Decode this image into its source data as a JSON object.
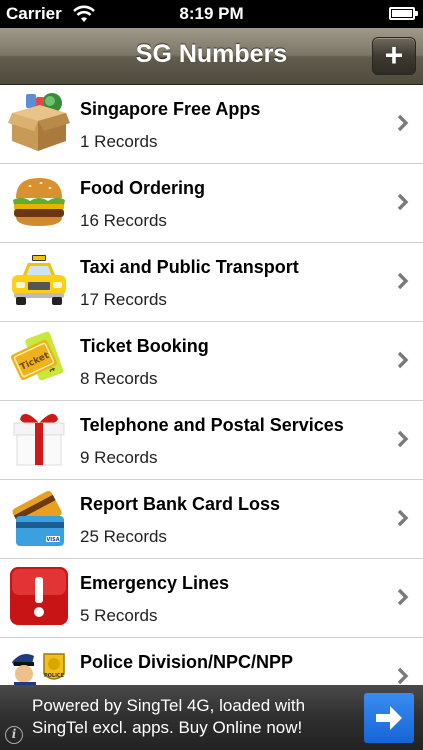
{
  "status": {
    "carrier": "Carrier",
    "time": "8:19 PM"
  },
  "nav": {
    "title": "SG Numbers",
    "add_label": "+"
  },
  "rows": [
    {
      "title": "Singapore Free Apps",
      "subtitle": "1 Records",
      "icon": "app-box-icon"
    },
    {
      "title": "Food Ordering",
      "subtitle": "16 Records",
      "icon": "burger-icon"
    },
    {
      "title": "Taxi and Public Transport",
      "subtitle": "17 Records",
      "icon": "taxi-icon"
    },
    {
      "title": "Ticket Booking",
      "subtitle": "8 Records",
      "icon": "ticket-icon"
    },
    {
      "title": "Telephone and Postal Services",
      "subtitle": "9 Records",
      "icon": "gift-icon"
    },
    {
      "title": "Report Bank Card Loss",
      "subtitle": "25 Records",
      "icon": "bank-card-icon"
    },
    {
      "title": "Emergency Lines",
      "subtitle": "5 Records",
      "icon": "emergency-icon"
    },
    {
      "title": "Police Division/NPC/NPP",
      "subtitle": "",
      "icon": "police-icon"
    }
  ],
  "ad": {
    "line1": "Powered by SingTel 4G, loaded with",
    "line2": "SingTel excl. apps. Buy Online now!",
    "info": "i"
  },
  "icon_texts": {
    "ticket": "Ticket",
    "ticket2": "Ticket",
    "police_badge": "POLICE",
    "visa": "VISA"
  }
}
